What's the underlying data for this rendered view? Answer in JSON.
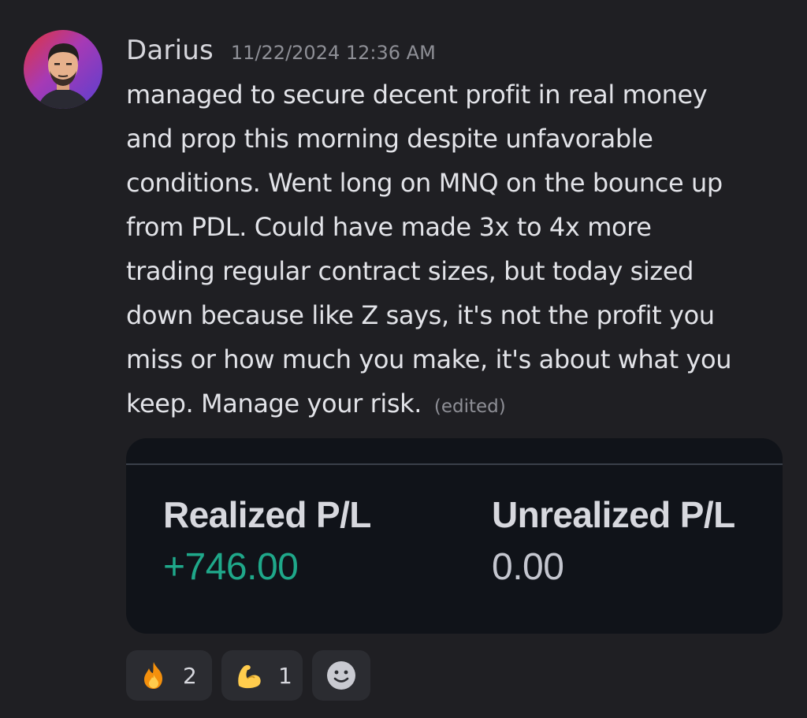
{
  "message": {
    "author": "Darius",
    "timestamp": "11/22/2024 12:36 AM",
    "lines": [
      "managed to secure decent profit in real money",
      "and prop this morning despite unfavorable",
      "conditions. Went long on MNQ on the bounce up",
      "from PDL. Could have made 3x to 4x more",
      "trading regular contract sizes, but today sized",
      "down because like Z says, it's not the profit you",
      "miss or how much you make, it's about what you",
      "keep. Manage your risk."
    ],
    "edited_label": "(edited)"
  },
  "attachment": {
    "realized_label": "Realized P/L",
    "realized_value": "+746.00",
    "unrealized_label": "Unrealized P/L",
    "unrealized_value": "0.00"
  },
  "reactions": [
    {
      "emoji": "fire-icon",
      "count": "2"
    },
    {
      "emoji": "flexed-biceps-icon",
      "count": "1"
    }
  ],
  "colors": {
    "background": "#1f1f23",
    "embed_background": "#101319",
    "profit_green": "#1fa88a",
    "value_gray": "#c4c6cf",
    "reaction_background": "#2b2c31"
  }
}
